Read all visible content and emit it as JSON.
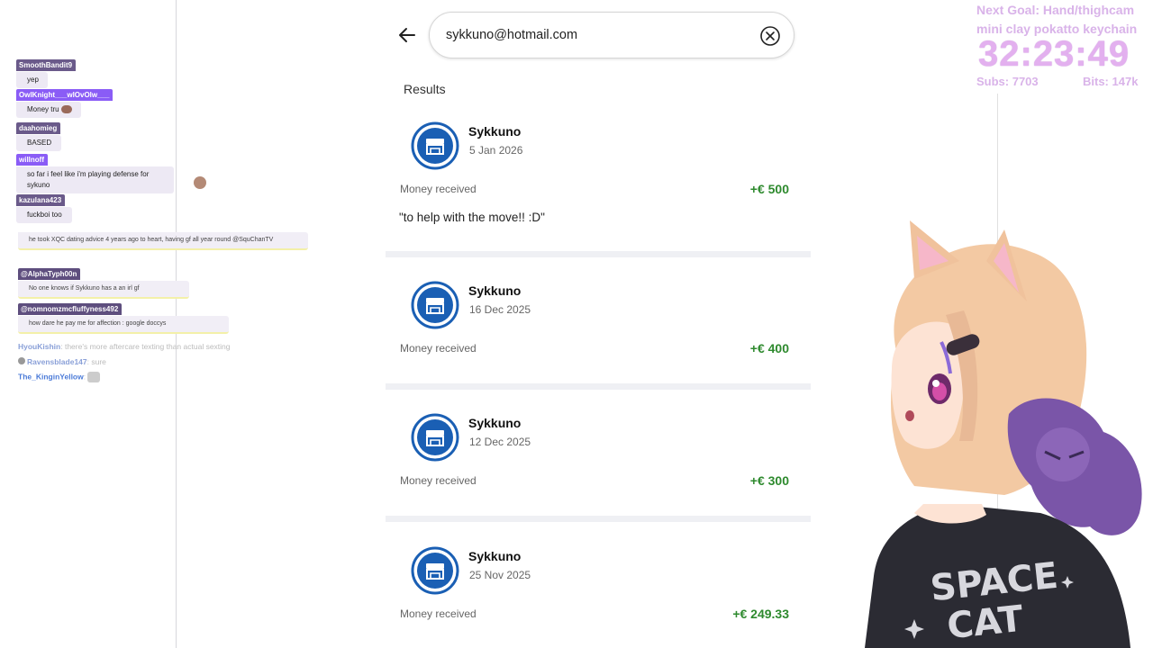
{
  "chat": {
    "messages": [
      {
        "user": "SmoothBandit9",
        "text": "yep"
      },
      {
        "user": "OwlKnight___wlOvOlw___",
        "text": "Money tru"
      },
      {
        "user": "daahomieg",
        "text": "BASED"
      },
      {
        "user": "willnoff",
        "text": "so far i feel like i'm playing defense for sykuno"
      },
      {
        "user": "kazulana423",
        "text": "fuckboi too"
      }
    ],
    "overlay_messages": [
      {
        "user": "",
        "text": "he took XQC dating advice 4 years ago to heart, having gf all year round @SquChanTV"
      },
      {
        "user": "@AlphaTyph00n",
        "text": "No one knows if Sykkuno has a an irl gf"
      },
      {
        "user": "@nomnomzmcfluffyness492",
        "text": "how dare he pay me for affection : google doccys"
      }
    ],
    "inline": [
      {
        "user": "HyouKishin",
        "text": "there's more aftercare texting than actual sexting"
      },
      {
        "user": "Ravensblade147",
        "text": "sure"
      },
      {
        "user": "The_KinginYellow",
        "text": ""
      }
    ]
  },
  "search": {
    "query": "sykkuno@hotmail.com"
  },
  "results_heading": "Results",
  "transactions": [
    {
      "name": "Sykkuno",
      "date": "5 Jan 2026",
      "kind": "Money received",
      "amount": "+€ 500",
      "note": "\"to help with the move!! :D\""
    },
    {
      "name": "Sykkuno",
      "date": "16 Dec 2025",
      "kind": "Money received",
      "amount": "+€ 400"
    },
    {
      "name": "Sykkuno",
      "date": "12 Dec 2025",
      "kind": "Money received",
      "amount": "+€ 300"
    },
    {
      "name": "Sykkuno",
      "date": "25 Nov 2025",
      "kind": "Money received",
      "amount": "+€ 249.33"
    }
  ],
  "stream": {
    "goal_line1": "Next Goal: Hand/thighcam",
    "goal_line2": "mini clay pokatto keychain",
    "timer": "32:23:49",
    "subs": "Subs: 7703",
    "bits": "Bits: 147k"
  },
  "avatar_shirt": {
    "line1": "SPACE",
    "line2": "CAT"
  },
  "colors": {
    "amount": "#2e8a2e",
    "logo_blue": "#1a5fb4",
    "overlay_pink": "#e3b0ef"
  }
}
